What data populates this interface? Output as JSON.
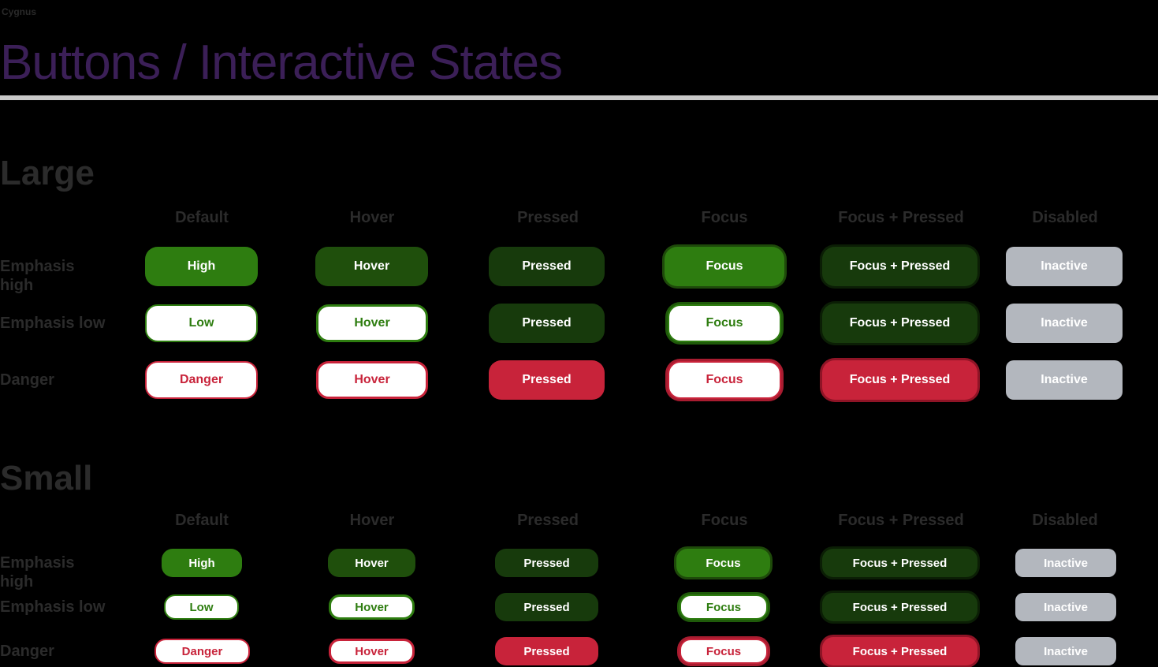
{
  "header": {
    "eyebrow": "Cygnus",
    "title": "Buttons / Interactive States"
  },
  "columns": [
    "Default",
    "Hover",
    "Pressed",
    "Focus",
    "Focus + Pressed",
    "Disabled"
  ],
  "rows": [
    "Emphasis high",
    "Emphasis low",
    "Danger"
  ],
  "large": {
    "title": "Large",
    "rows": [
      [
        "High",
        "Hover",
        "Pressed",
        "Focus",
        "Focus + Pressed",
        "Inactive"
      ],
      [
        "Low",
        "Hover",
        "Pressed",
        "Focus",
        "Focus + Pressed",
        "Inactive"
      ],
      [
        "Danger",
        "Hover",
        "Pressed",
        "Focus",
        "Focus + Pressed",
        "Inactive"
      ]
    ]
  },
  "small": {
    "title": "Small",
    "rows": [
      [
        "High",
        "Hover",
        "Pressed",
        "Focus",
        "Focus + Pressed",
        "Inactive"
      ],
      [
        "Low",
        "Hover",
        "Pressed",
        "Focus",
        "Focus + Pressed",
        "Inactive"
      ],
      [
        "Danger",
        "Hover",
        "Pressed",
        "Focus",
        "Focus + Pressed",
        "Inactive"
      ]
    ]
  },
  "colors": {
    "background": "#000000",
    "title": "#3b1f57",
    "primary_green": "#2e7d10",
    "hover_green": "#1f4f0c",
    "pressed_green": "#173a0c",
    "danger_red": "#c8233a",
    "disabled_gray": "#b3b7be"
  }
}
